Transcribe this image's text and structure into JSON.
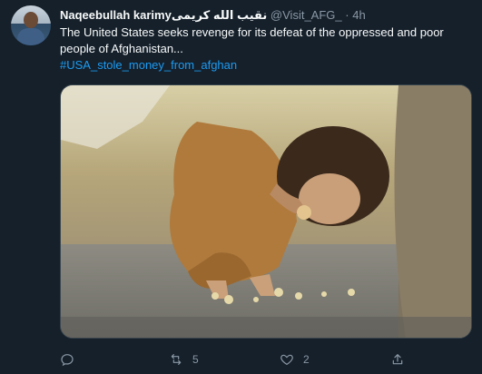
{
  "tweet": {
    "author_name": "Naqeebullah karimyنقیب الله کریمی",
    "handle": "@Visit_AFG_",
    "separator": "·",
    "time": "4h",
    "text_lines": [
      "The United States seeks revenge for its defeat of the oppressed and poor",
      "people of Afghanistan..."
    ],
    "hashtag": "#USA_stole_money_from_afghan"
  },
  "actions": {
    "reply_count": "",
    "retweet_count": "5",
    "like_count": "2",
    "share_count": ""
  },
  "icons": {
    "reply": "reply-icon",
    "retweet": "retweet-icon",
    "like": "like-icon",
    "share": "share-icon"
  },
  "colors": {
    "background": "#15202b",
    "text": "#f7f9f9",
    "secondary": "#8b98a5",
    "accent": "#1d9bf0"
  }
}
